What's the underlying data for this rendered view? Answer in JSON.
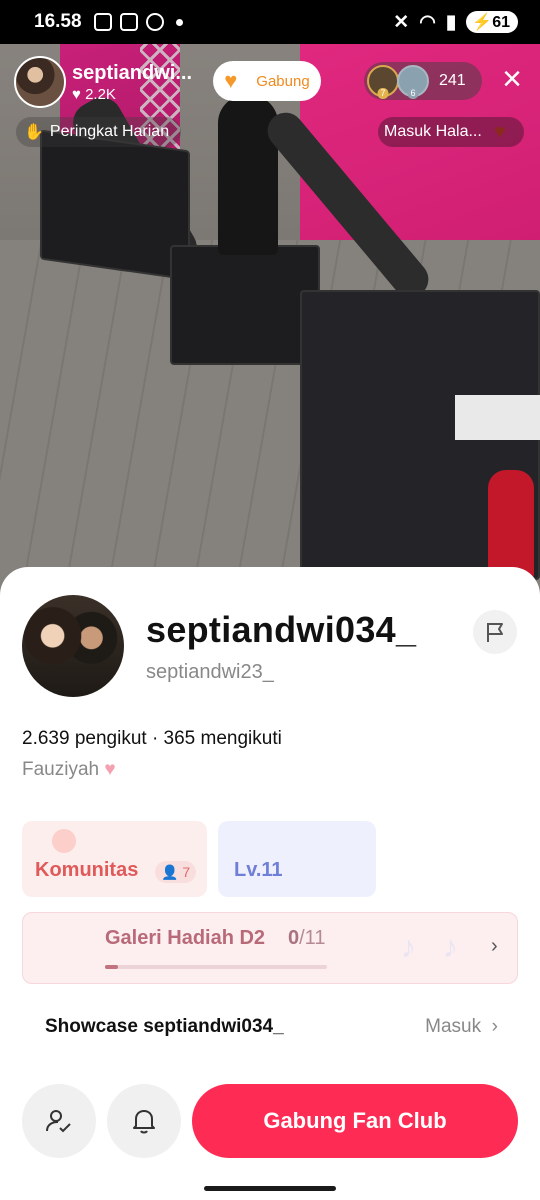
{
  "status_bar": {
    "time": "16.58",
    "battery": "61"
  },
  "live": {
    "host_name": "septiandwi...",
    "host_likes": "2.2K",
    "join_label": "Gabung",
    "viewer_levels": [
      "7",
      "6"
    ],
    "viewer_count": "241",
    "rank_label": "Peringkat Harian",
    "enter_label": "Masuk Hala..."
  },
  "profile": {
    "display_name": "septiandwi034_",
    "handle": "septiandwi23_",
    "stats": "2.639 pengikut · 365 mengikuti",
    "bio": "Fauziyah",
    "community_label": "Komunitas",
    "community_count": "7",
    "level_label": "Lv.11",
    "gift_gallery_title": "Galeri Hadiah D2",
    "gift_progress_current": "0",
    "gift_progress_total": "/11",
    "gift_progress_fraction": 0.06,
    "showcase_label": "Showcase septiandwi034_",
    "showcase_enter": "Masuk",
    "fan_club_button": "Gabung Fan Club"
  },
  "colors": {
    "primary_red": "#fe2c55",
    "community_bg": "#fdeeee",
    "level_bg": "#eef0fd"
  },
  "icons": [
    "flag-icon",
    "user-check-icon",
    "bell-icon",
    "close-icon",
    "heart-icon",
    "chevron-right-icon"
  ]
}
